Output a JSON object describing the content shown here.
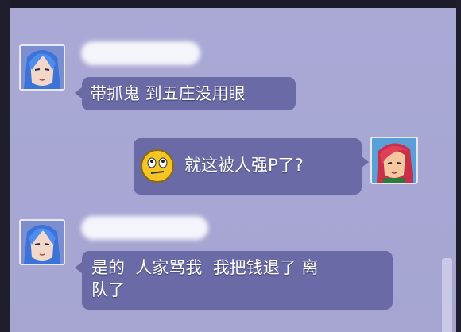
{
  "messages": [
    {
      "sender": "npc-blue-hair",
      "side": "left",
      "text": "带抓鬼 到五庄没用眼"
    },
    {
      "sender": "player-red-hair",
      "side": "right",
      "emoji": "rolling-eyes-emoji",
      "text": "就这被人强P了?"
    },
    {
      "sender": "npc-blue-hair",
      "side": "left",
      "text": "是的  人家骂我  我把钱退了 离\n队了"
    }
  ],
  "colors": {
    "background": "#a9a8d4",
    "bubble": "#6a6aa6",
    "text": "#ffffff",
    "name_blur": "#f4f4fb"
  }
}
